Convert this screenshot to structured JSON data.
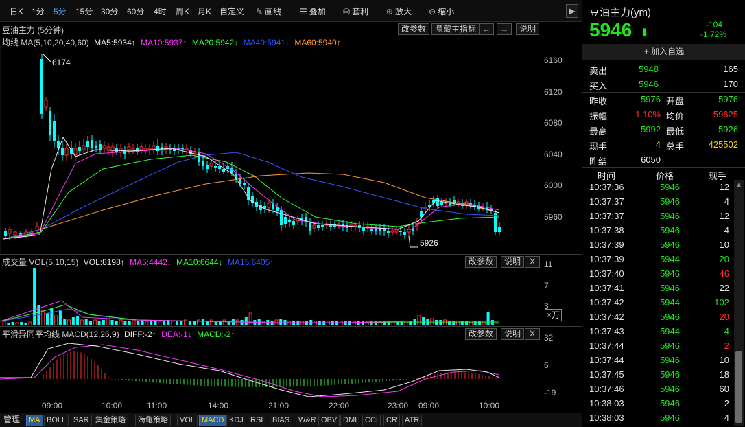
{
  "toolbar": {
    "timeframes": [
      "日K",
      "1分",
      "5分",
      "15分",
      "30分",
      "60分",
      "4时",
      "周K",
      "月K",
      "自定义"
    ],
    "active_timeframe": "5分",
    "tools": [
      {
        "icon": "pencil-icon",
        "label": "画线"
      },
      {
        "icon": "stack-icon",
        "label": "叠加"
      },
      {
        "icon": "moneybag-icon",
        "label": "套利"
      },
      {
        "icon": "zoom-in-icon",
        "label": "放大"
      },
      {
        "icon": "zoom-out-icon",
        "label": "缩小"
      }
    ],
    "next_label": "▶"
  },
  "main_panel": {
    "title": "豆油主力 (5分钟)",
    "buttons": [
      "改参数",
      "隐藏主指标",
      "←",
      "→",
      "说明"
    ],
    "legend": {
      "prefix": "均线 MA(5,10,20,40,60)",
      "items": [
        {
          "text": "MA5:5934↑",
          "color": "#e8e8e8"
        },
        {
          "text": "MA10:5937↑",
          "color": "#ff33ff"
        },
        {
          "text": "MA20:5942↓",
          "color": "#33ff33"
        },
        {
          "text": "MA40:5941↓",
          "color": "#3355ff"
        },
        {
          "text": "MA60:5940↑",
          "color": "#ff9933"
        }
      ]
    },
    "y_ticks": [
      "6160",
      "6120",
      "6080",
      "6040",
      "6000",
      "5960"
    ],
    "high_label": "6174",
    "low_label": "5926"
  },
  "volume_panel": {
    "title": "成交量 VOL(5,10,15)",
    "legend": [
      {
        "text": "VOL:8198↑",
        "color": "#e8e8e8"
      },
      {
        "text": "MA5:4442↓",
        "color": "#ff33ff"
      },
      {
        "text": "MA10:6644↓",
        "color": "#33ff33"
      },
      {
        "text": "MA15:6405↑",
        "color": "#3355ff"
      }
    ],
    "buttons": [
      "改参数",
      "说明",
      "X"
    ],
    "y_ticks": [
      "11",
      "7",
      "3"
    ],
    "unit": "×万"
  },
  "macd_panel": {
    "title": "平滑异同平均线 MACD(12,26,9)",
    "legend": [
      {
        "text": "DIFF:-2↑",
        "color": "#e8e8e8"
      },
      {
        "text": "DEA:-1↓",
        "color": "#ff33ff"
      },
      {
        "text": "MACD:-2↑",
        "color": "#33ff33"
      }
    ],
    "buttons": [
      "改参数",
      "说明",
      "X"
    ],
    "y_ticks": [
      "32",
      "6",
      "-19"
    ]
  },
  "x_ticks": [
    "09:00",
    "10:00",
    "11:00",
    "14:00",
    "21:00",
    "22:00",
    "23:00",
    "09:00",
    "10:00"
  ],
  "indicator_bar": [
    "管理",
    "MA",
    "BOLL",
    "SAR",
    "集金策略",
    "海龟策略",
    "VOL",
    "MACD",
    "KDJ",
    "RSI",
    "BIAS",
    "W&R",
    "OBV",
    "DMI",
    "CCI",
    "CR",
    "ATR"
  ],
  "active_indicators": [
    "MA",
    "MACD"
  ],
  "quote": {
    "name": "豆油主力(ym)",
    "price": "5946",
    "change": "-104",
    "change_pct": "-1.72%",
    "watch_label": "+ 加入自选",
    "sell_label": "卖出",
    "sell_price": "5948",
    "sell_vol": "165",
    "buy_label": "买入",
    "buy_price": "5946",
    "buy_vol": "170",
    "stats": [
      {
        "l1": "昨收",
        "v1": "5976",
        "c1": "green",
        "l2": "开盘",
        "v2": "5976",
        "c2": "green"
      },
      {
        "l1": "振幅",
        "v1": "1.10%",
        "c1": "red",
        "l2": "均价",
        "v2": "59625",
        "c2": "red"
      },
      {
        "l1": "最高",
        "v1": "5992",
        "c1": "green",
        "l2": "最低",
        "v2": "5926",
        "c2": "green"
      },
      {
        "l1": "现手",
        "v1": "4",
        "c1": "yellow",
        "l2": "总手",
        "v2": "425502",
        "c2": "yellow"
      },
      {
        "l1": "昨结",
        "v1": "6050",
        "c1": "white",
        "l2": "",
        "v2": "",
        "c2": "white"
      }
    ]
  },
  "trades_header": [
    "时间",
    "价格",
    "现手"
  ],
  "trades": [
    {
      "time": "10:37:36",
      "price": "5946",
      "vol": "12",
      "vc": "white"
    },
    {
      "time": "10:37:37",
      "price": "5946",
      "vol": "4",
      "vc": "white"
    },
    {
      "time": "10:37:37",
      "price": "5946",
      "vol": "12",
      "vc": "white"
    },
    {
      "time": "10:37:38",
      "price": "5946",
      "vol": "4",
      "vc": "white"
    },
    {
      "time": "10:37:39",
      "price": "5946",
      "vol": "10",
      "vc": "white"
    },
    {
      "time": "10:37:39",
      "price": "5944",
      "vol": "20",
      "vc": "green"
    },
    {
      "time": "10:37:40",
      "price": "5946",
      "vol": "46",
      "vc": "red"
    },
    {
      "time": "10:37:41",
      "price": "5946",
      "vol": "22",
      "vc": "white"
    },
    {
      "time": "10:37:42",
      "price": "5944",
      "vol": "102",
      "vc": "green"
    },
    {
      "time": "10:37:42",
      "price": "5946",
      "vol": "20",
      "vc": "red"
    },
    {
      "time": "10:37:43",
      "price": "5944",
      "vol": "4",
      "vc": "green"
    },
    {
      "time": "10:37:44",
      "price": "5946",
      "vol": "2",
      "vc": "red"
    },
    {
      "time": "10:37:44",
      "price": "5946",
      "vol": "10",
      "vc": "white"
    },
    {
      "time": "10:37:45",
      "price": "5946",
      "vol": "18",
      "vc": "white"
    },
    {
      "time": "10:37:46",
      "price": "5946",
      "vol": "60",
      "vc": "white"
    },
    {
      "time": "10:38:03",
      "price": "5946",
      "vol": "2",
      "vc": "white"
    },
    {
      "time": "10:38:03",
      "price": "5946",
      "vol": "4",
      "vc": "white"
    }
  ]
}
